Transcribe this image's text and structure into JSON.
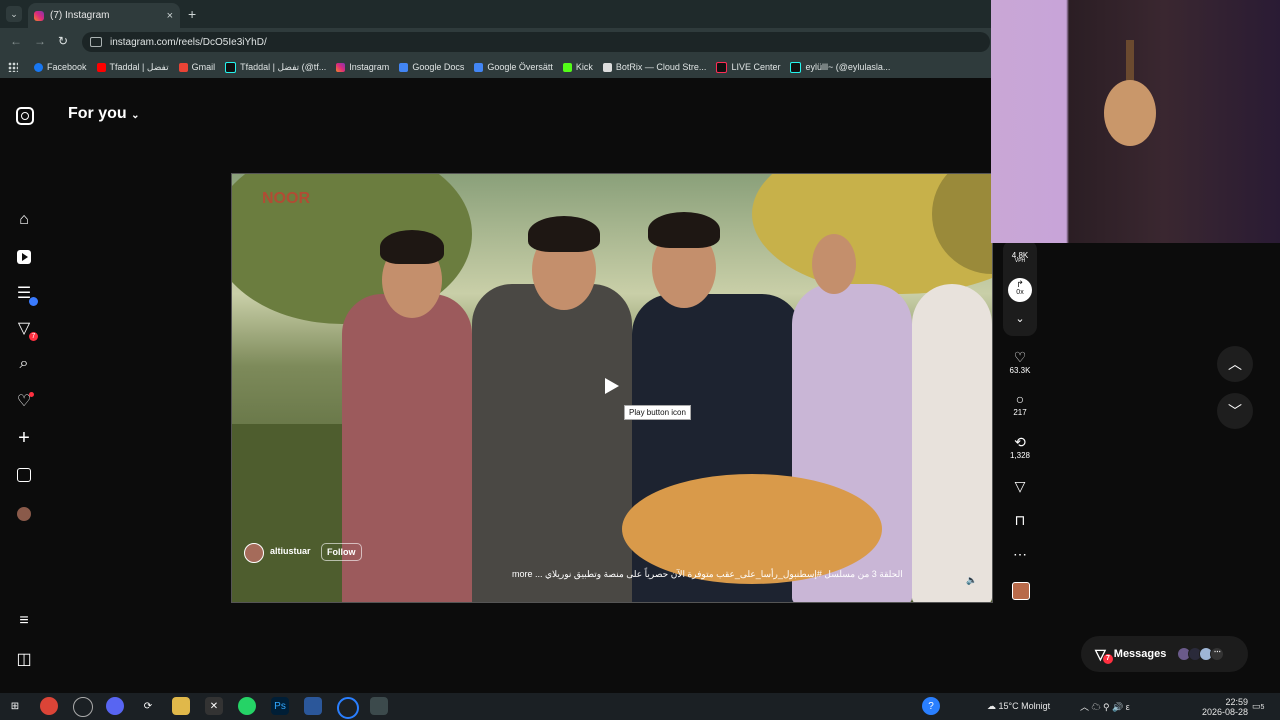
{
  "browser": {
    "tab_title": "(7) Instagram",
    "tab_close": "×",
    "new_tab": "+",
    "url": "instagram.com/reels/DcO5Ie3iYhD/",
    "bookmarks": [
      "Facebook",
      "Tfaddal | تفضل",
      "Gmail",
      "Tfaddal | تفضل (@tf...",
      "Instagram",
      "Google Docs",
      "Google Översätt",
      "Kick",
      "BotRix — Cloud Stre...",
      "LIVE Center",
      "eylülll~ (@eylulasla..."
    ]
  },
  "sidebar": {
    "header": "For you",
    "notifications_badge": "7"
  },
  "video": {
    "watermark": "NOOR",
    "tooltip": "Play button icon",
    "author": "altiustuar",
    "follow_label": "Follow",
    "caption": "more ... الحلقة 3 من مسلسل #إسطنبول_رأسا_على_عقب متوفرة الآن حصرياً على منصة وتطبيق نوريلاي"
  },
  "actions": {
    "views": "4.8K",
    "views_unit": "VPH",
    "rate": "0x",
    "likes": "63.3K",
    "comments": "217",
    "reposts": "1,328"
  },
  "messages": {
    "label": "Messages",
    "badge": "7"
  },
  "taskbar": {
    "weather": "15°C  Molnigt",
    "time": "22:59",
    "date": "2026-08-28",
    "notif_count": "5"
  }
}
